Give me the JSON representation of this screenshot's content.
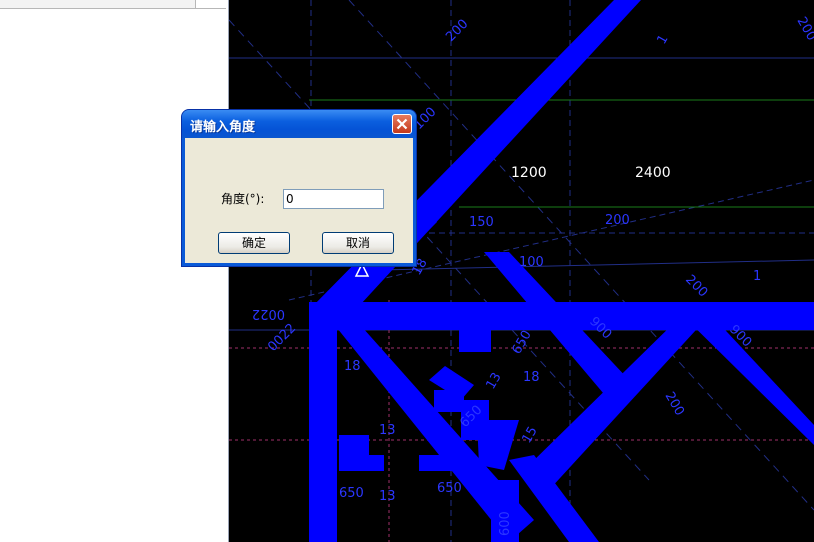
{
  "dialog": {
    "title": "请输入角度",
    "label": "角度(°):",
    "input_value": "0",
    "ok_label": "确定",
    "cancel_label": "取消"
  },
  "cad": {
    "dimension_labels": [
      "200",
      "100",
      "1200",
      "2400",
      "150",
      "200",
      "100",
      "200",
      "0022",
      "0022",
      "900",
      "900",
      "650",
      "650",
      "650",
      "13",
      "18",
      "13",
      "15",
      "18",
      "650",
      "600",
      "13",
      "18",
      "200",
      "200",
      "1",
      "1"
    ]
  },
  "colors": {
    "cad_background": "#000000",
    "wall_blue": "#0000ff",
    "title_bar": "#0b5fdf",
    "dialog_face": "#ece9d8"
  },
  "icons": [
    "close-icon",
    "ucs-triangle-icon"
  ]
}
